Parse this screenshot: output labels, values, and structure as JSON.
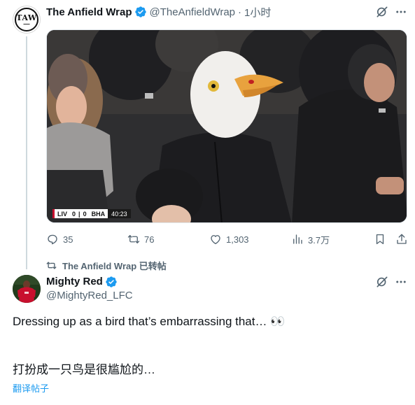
{
  "tweet1": {
    "avatar_text": "TAW",
    "display_name": "The Anfield Wrap",
    "handle": "@TheAnfieldWrap",
    "separator": "·",
    "time": "1小时",
    "scorebug": {
      "home": "LIV",
      "home_score": "0",
      "away_score": "0",
      "away": "BHA",
      "clock": "40:23"
    },
    "actions": {
      "replies": "35",
      "reposts": "76",
      "likes": "1,303",
      "views": "3.7万"
    }
  },
  "repost_context": "The Anfield Wrap 已转帖",
  "tweet2": {
    "display_name": "Mighty Red",
    "handle": "@MightyRed_LFC",
    "text": "Dressing up as a bird that’s embarrassing that… 👀",
    "translation": "打扮成一只鸟是很尴尬的…",
    "translate_link": "翻译帖子"
  },
  "colors": {
    "verified_blue": "#1d9bf0",
    "secondary_text": "#536471",
    "link_blue": "#1d9bf0",
    "text_primary": "#0f1419"
  },
  "icons": [
    "grok-icon",
    "more-icon",
    "reply-icon",
    "repost-icon",
    "like-icon",
    "views-icon",
    "bookmark-icon",
    "share-icon",
    "verified-icon"
  ]
}
